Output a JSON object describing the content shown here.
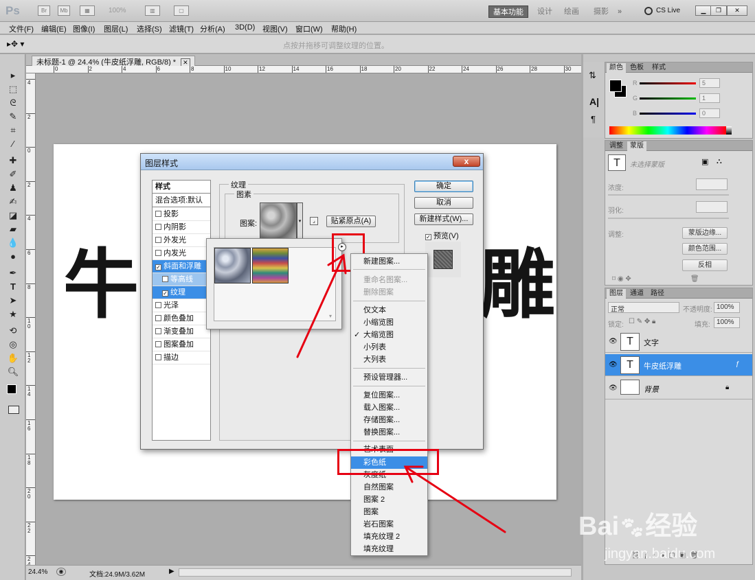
{
  "app": {
    "logo": "Ps",
    "zoom": "100%",
    "workspaces": [
      "基本功能",
      "设计",
      "绘画",
      "摄影"
    ],
    "workspace_more": "»",
    "cslive": "CS Live"
  },
  "menu": [
    "文件(F)",
    "编辑(E)",
    "图像(I)",
    "图层(L)",
    "选择(S)",
    "滤镜(T)",
    "分析(A)",
    "3D(D)",
    "视图(V)",
    "窗口(W)",
    "帮助(H)"
  ],
  "options_hint": "点按并拖移可调整纹理的位置。",
  "document": {
    "tab_title": "未标题-1 @ 24.4% (牛皮纸浮雕, RGB/8) *",
    "canvas_left_char": "牛",
    "canvas_right_char": "雕"
  },
  "ruler_h": [
    "0",
    "2",
    "4",
    "6",
    "8",
    "10",
    "12",
    "14",
    "16",
    "18",
    "20",
    "22",
    "24",
    "26",
    "28",
    "30"
  ],
  "ruler_v": [
    "4",
    "2",
    "0",
    "2",
    "4",
    "6",
    "8",
    "1\n0",
    "1\n2",
    "1\n4",
    "1\n6",
    "1\n8",
    "2\n0",
    "2\n2",
    "2\n4",
    "2\n6"
  ],
  "status": {
    "zoom": "24.4%",
    "doc": "文档:24.9M/3.62M"
  },
  "color_panel": {
    "tabs": [
      "颜色",
      "色板",
      "样式"
    ],
    "channels": [
      {
        "label": "R",
        "value": "5"
      },
      {
        "label": "G",
        "value": "1"
      },
      {
        "label": "B",
        "value": "0"
      }
    ]
  },
  "masks_panel": {
    "tabs": [
      "调整",
      "蒙版"
    ],
    "no_selection": "未选择蒙版",
    "density": "浓度:",
    "feather": "羽化:",
    "refine": "调整:",
    "btn_edge": "蒙版边缘...",
    "btn_range": "颜色范围...",
    "btn_invert": "反相"
  },
  "layers_panel": {
    "tabs": [
      "图层",
      "通道",
      "路径"
    ],
    "blend": "正常",
    "opacity_label": "不透明度:",
    "opacity": "100%",
    "lock_label": "锁定:",
    "fill_label": "填充:",
    "fill": "100%",
    "layers": [
      {
        "name": "文字",
        "thumb": "T"
      },
      {
        "name": "牛皮纸浮雕",
        "thumb": "T"
      },
      {
        "name": "背景",
        "thumb": ""
      }
    ]
  },
  "dialog": {
    "title": "图层样式",
    "close": "x",
    "styles": [
      "样式",
      "混合选项:默认",
      "投影",
      "内阴影",
      "外发光",
      "内发光",
      "斜面和浮雕",
      "等高线",
      "纹理",
      "光泽",
      "颜色叠加",
      "渐变叠加",
      "图案叠加",
      "描边"
    ],
    "section": "纹理",
    "group": "图素",
    "pattern_label": "图案:",
    "snap_btn": "贴紧原点(A)",
    "ok": "确定",
    "cancel": "取消",
    "new_style": "新建样式(W)...",
    "preview": "预览(V)"
  },
  "context_menu": {
    "items": [
      "新建图案...",
      "重命名图案...",
      "删除图案",
      "仅文本",
      "小缩览图",
      "大缩览图",
      "小列表",
      "大列表",
      "预设管理器...",
      "复位图案...",
      "载入图案...",
      "存储图案...",
      "替换图案...",
      "艺术表面",
      "彩色纸",
      "灰度纸",
      "自然图案",
      "图案 2",
      "图案",
      "岩石图案",
      "填充纹理 2",
      "填充纹理"
    ]
  },
  "watermark": {
    "brand": "Bai",
    "brand_cn": "经验",
    "url": "jingyan.baidu.com"
  }
}
